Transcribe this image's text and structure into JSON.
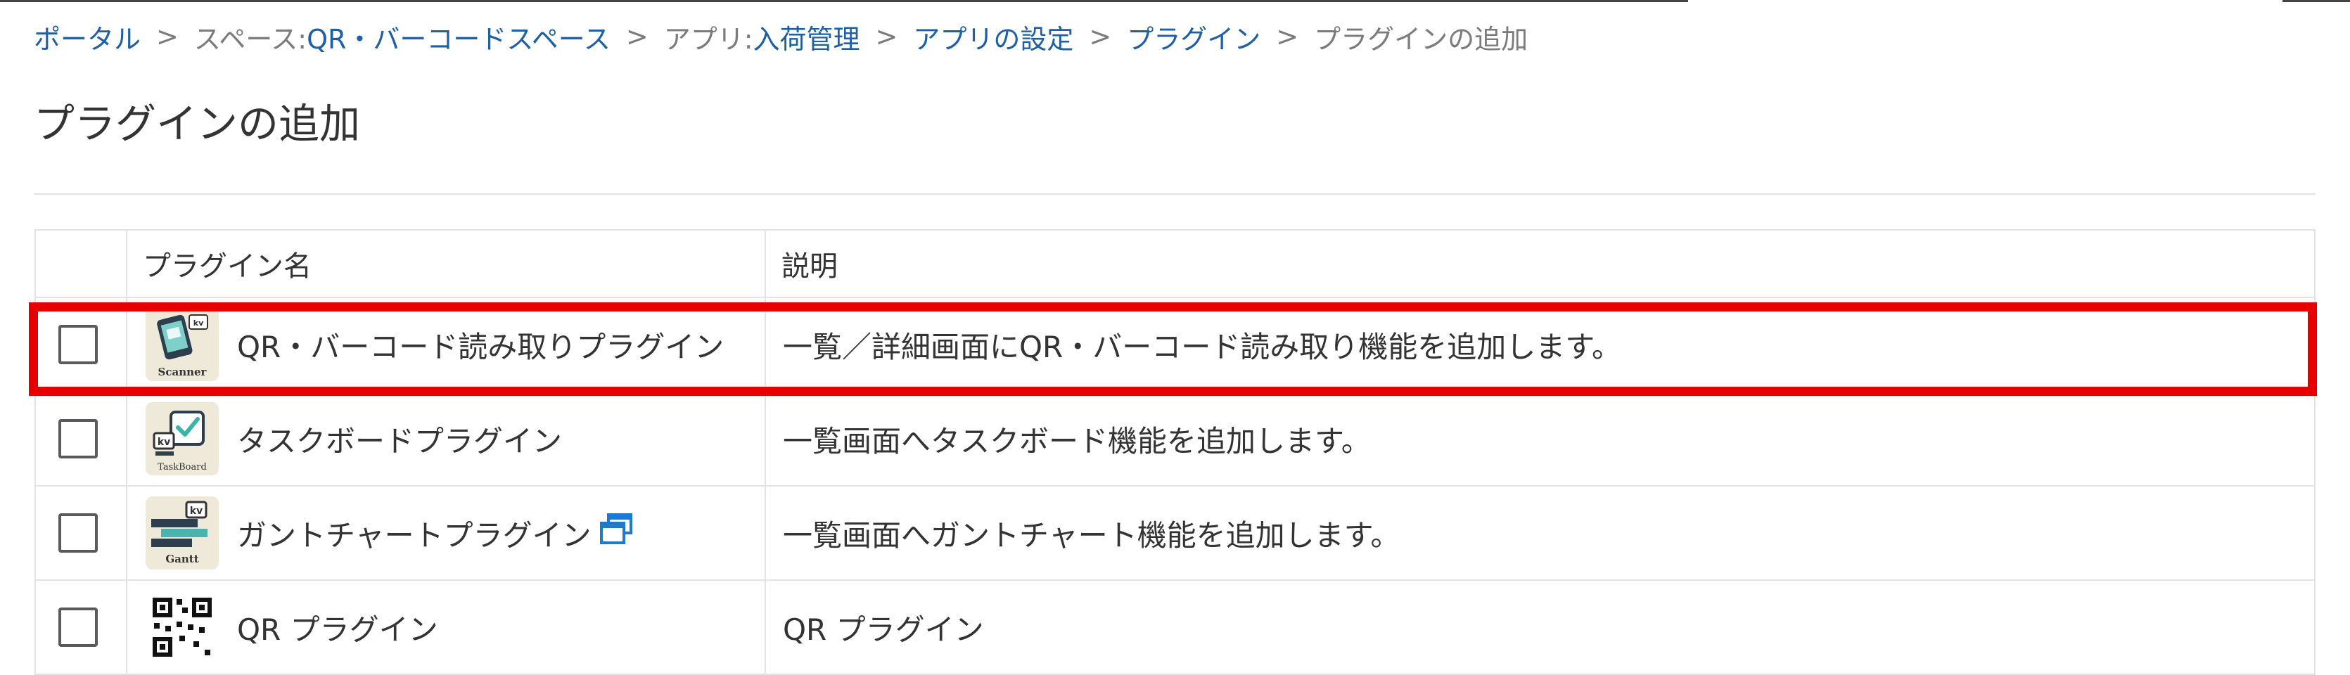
{
  "breadcrumb": {
    "portal": "ポータル",
    "sep": ">",
    "space_prefix": "スペース: ",
    "space_name": "QR・バーコードスペース",
    "app_prefix": "アプリ: ",
    "app_name": "入荷管理",
    "app_settings": "アプリの設定",
    "plugins": "プラグイン",
    "current": "プラグインの追加"
  },
  "page": {
    "title": "プラグインの追加"
  },
  "table": {
    "headers": {
      "name": "プラグイン名",
      "description": "説明"
    },
    "rows": [
      {
        "name": "QR・バーコード読み取りプラグイン",
        "description": "一覧／詳細画面にQR・バーコード読み取り機能を追加します。",
        "icon": "scanner-plugin-icon",
        "icon_label": "Scanner",
        "checked": false,
        "highlighted": true
      },
      {
        "name": "タスクボードプラグイン",
        "description": "一覧画面へタスクボード機能を追加します。",
        "icon": "taskboard-plugin-icon",
        "icon_label": "TaskBoard",
        "checked": false
      },
      {
        "name": "ガントチャートプラグイン",
        "description": "一覧画面へガントチャート機能を追加します。",
        "icon": "gantt-plugin-icon",
        "icon_label": "Gantt",
        "checked": false,
        "has_external_link": true
      },
      {
        "name": "QR プラグイン",
        "description": "QR プラグイン",
        "icon": "qr-code-icon",
        "checked": false
      }
    ]
  },
  "colors": {
    "link": "#1f5fa6",
    "muted": "#7b7b7b",
    "highlight": "#e60000",
    "border": "#e3e3e3"
  }
}
